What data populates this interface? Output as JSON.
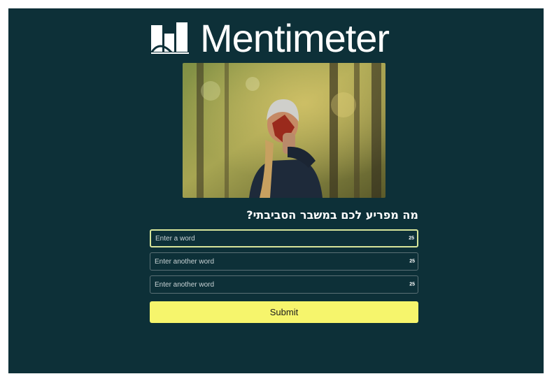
{
  "brand": {
    "name": "Mentimeter",
    "logo_icon": "mentimeter-bars-icon",
    "background_color": "#0d3038",
    "accent_color": "#f6f56c"
  },
  "hero_image": {
    "icon": "photo-person-in-forest-holding-leaf"
  },
  "question": {
    "text": "מה מפריע לכם במשבר הסביבתי?"
  },
  "inputs": [
    {
      "placeholder": "Enter a word",
      "counter": "25"
    },
    {
      "placeholder": "Enter another word",
      "counter": "25"
    },
    {
      "placeholder": "Enter another word",
      "counter": "25"
    }
  ],
  "submit": {
    "label": "Submit"
  }
}
